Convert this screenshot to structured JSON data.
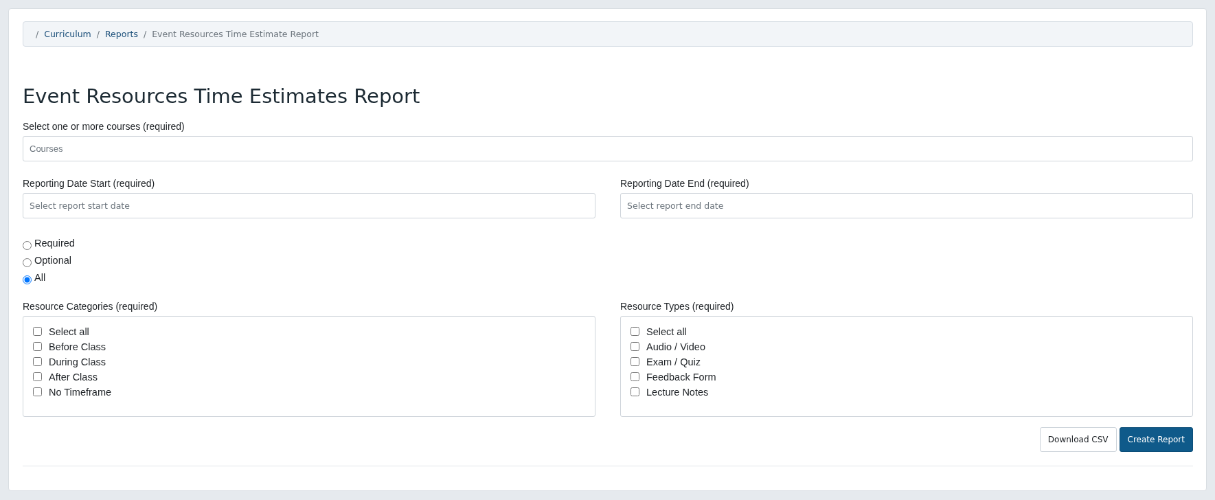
{
  "breadcrumb": [
    {
      "separator": "/",
      "label": "Curriculum",
      "link": true
    },
    {
      "separator": "/",
      "label": "Reports",
      "link": true
    },
    {
      "separator": "/",
      "label": "Event Resources Time Estimate Report",
      "link": false
    }
  ],
  "title": "Event Resources Time Estimates Report",
  "courses": {
    "label": "Select one or more courses (required)",
    "placeholder": "Courses"
  },
  "dates": [
    {
      "label": "Reporting Date Start (required)",
      "placeholder": "Select report start date"
    },
    {
      "label": "Reporting Date End (required)",
      "placeholder": "Select report end date"
    }
  ],
  "requirement": [
    {
      "label": "Required",
      "selected": false
    },
    {
      "label": "Optional",
      "selected": false
    },
    {
      "label": "All",
      "selected": true
    }
  ],
  "checklists": [
    {
      "label": "Resource Categories (required)",
      "items": [
        {
          "label": "Select all",
          "checked": false
        },
        {
          "label": "Before Class",
          "checked": false
        },
        {
          "label": "During Class",
          "checked": false
        },
        {
          "label": "After Class",
          "checked": false
        },
        {
          "label": "No Timeframe",
          "checked": false
        }
      ]
    },
    {
      "label": "Resource Types (required)",
      "items": [
        {
          "label": "Select all",
          "checked": false
        },
        {
          "label": "Audio / Video",
          "checked": false
        },
        {
          "label": "Exam / Quiz",
          "checked": false
        },
        {
          "label": "Feedback Form",
          "checked": false
        },
        {
          "label": "Lecture Notes",
          "checked": false
        }
      ]
    }
  ],
  "buttons": [
    {
      "label": "Download CSV",
      "kind": "secondary"
    },
    {
      "label": "Create Report",
      "kind": "primary"
    }
  ]
}
